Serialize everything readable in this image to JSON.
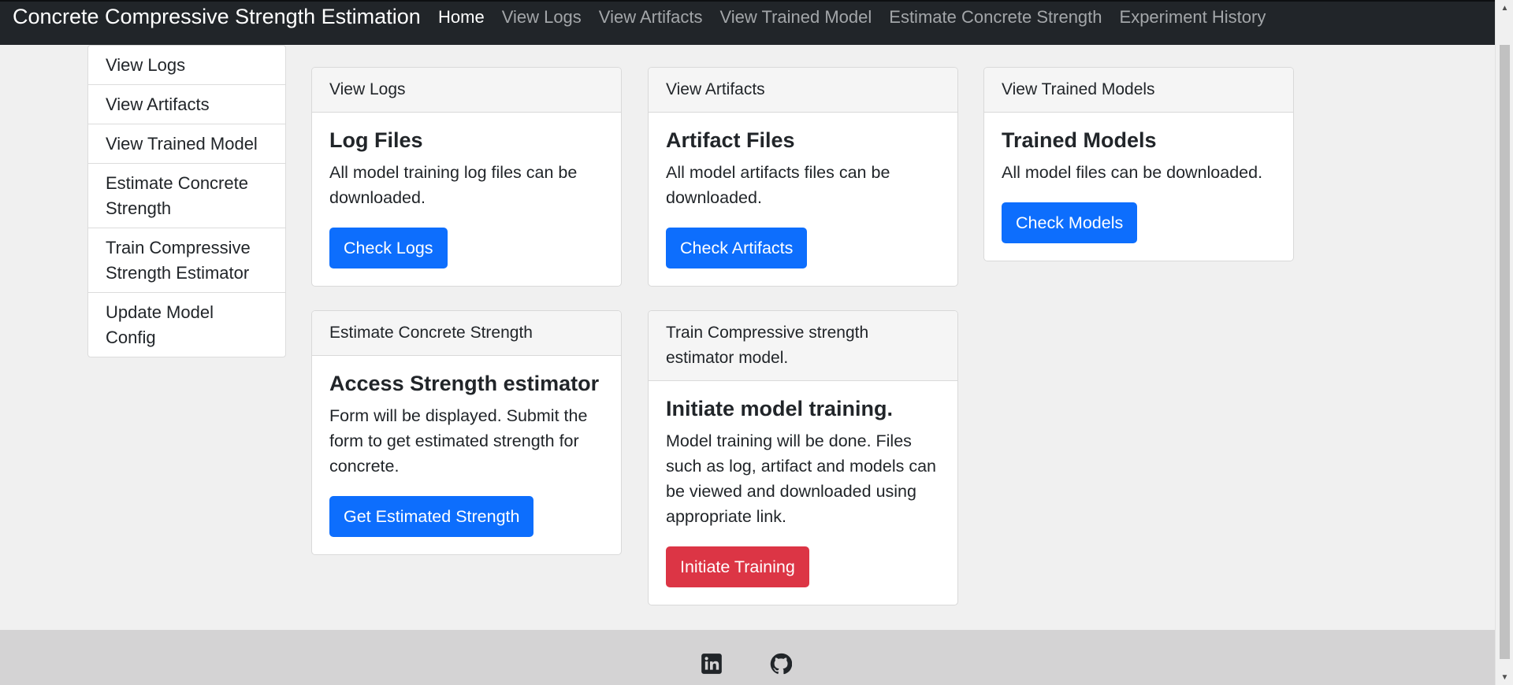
{
  "navbar": {
    "brand": "Concrete Compressive Strength Estimation",
    "links": [
      {
        "label": "Home",
        "active": true
      },
      {
        "label": "View Logs"
      },
      {
        "label": "View Artifacts"
      },
      {
        "label": "View Trained Model"
      },
      {
        "label": "Estimate Concrete Strength"
      },
      {
        "label": "Experiment History"
      }
    ]
  },
  "sidebar": {
    "items": [
      {
        "label": "View Logs"
      },
      {
        "label": "View Artifacts"
      },
      {
        "label": "View Trained Model"
      },
      {
        "label": "Estimate Concrete Strength"
      },
      {
        "label": "Train Compressive Strength Estimator"
      },
      {
        "label": "Update Model Config"
      }
    ]
  },
  "cards": [
    {
      "header": "View Logs",
      "title": "Log Files",
      "text": "All model training log files can be downloaded.",
      "button": "Check Logs"
    },
    {
      "header": "View Artifacts",
      "title": "Artifact Files",
      "text": "All model artifacts files can be downloaded.",
      "button": "Check Artifacts"
    },
    {
      "header": "View Trained Models",
      "title": "Trained Models",
      "text": "All model files can be downloaded.",
      "button": "Check Models"
    },
    {
      "header": "Estimate Concrete Strength",
      "title": "Access Strength estimator",
      "text": "Form will be displayed. Submit the form to get estimated strength for concrete.",
      "button": "Get Estimated Strength"
    },
    {
      "header": "Train Compressive strength estimator model.",
      "title": "Initiate model training.",
      "text": "Model training will be done. Files such as log, artifact and models can be viewed and downloaded using appropriate link.",
      "button": "Initiate Training"
    }
  ],
  "footer": {
    "icons": [
      "linkedin-icon",
      "github-icon"
    ]
  },
  "colors": {
    "navbar_bg": "#212529",
    "primary": "#0d6efd",
    "danger": "#dc3545",
    "page_bg": "#f0f0f0",
    "footer_bg": "#d4d3d4"
  }
}
